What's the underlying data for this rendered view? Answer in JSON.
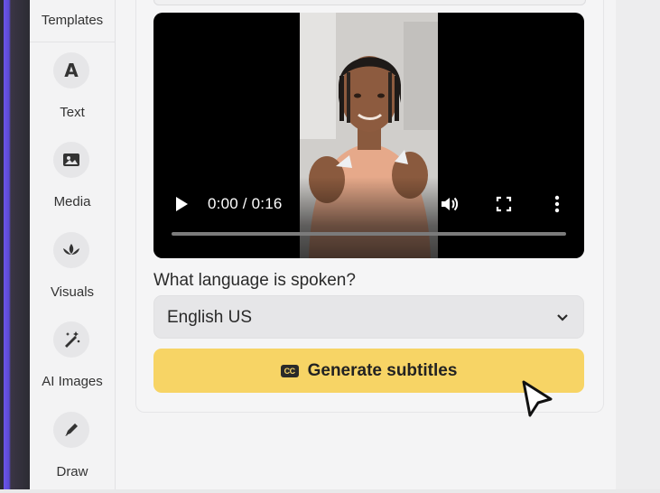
{
  "sidebar": {
    "top_label": "Templates",
    "items": [
      {
        "label": "Text",
        "icon": "text-a-icon"
      },
      {
        "label": "Media",
        "icon": "image-icon"
      },
      {
        "label": "Visuals",
        "icon": "lotus-icon"
      },
      {
        "label": "AI Images",
        "icon": "magic-wand-icon"
      },
      {
        "label": "Draw",
        "icon": "pen-icon"
      }
    ]
  },
  "video": {
    "time": "0:00 / 0:16",
    "progress": 0
  },
  "form": {
    "question": "What language is spoken?",
    "language_value": "English US",
    "generate_label": "Generate subtitles",
    "generate_icon_text": "CC"
  },
  "colors": {
    "button": "#f7d465",
    "accent_edge": "#6b55e8"
  }
}
